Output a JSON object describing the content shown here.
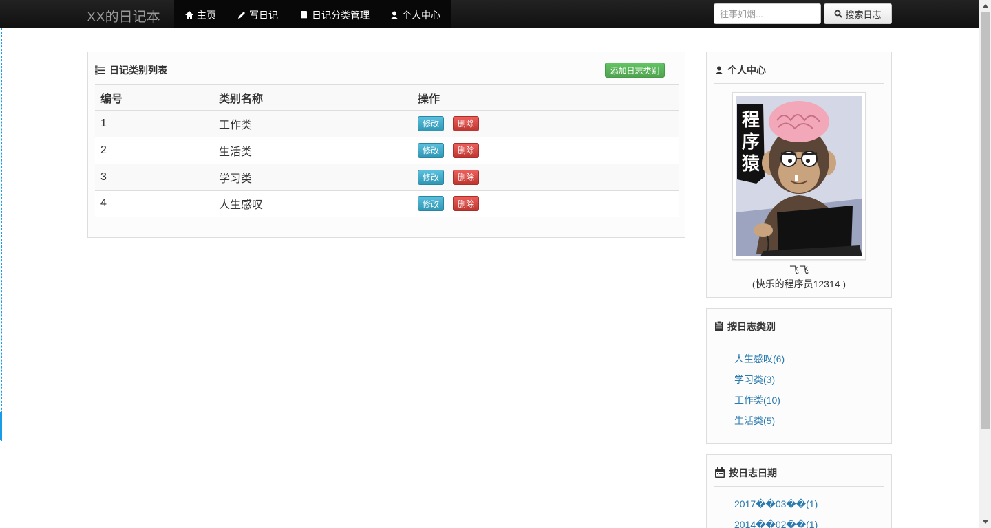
{
  "navbar": {
    "brand": "XX的日记本",
    "items": [
      {
        "label": "主页",
        "icon": "home-icon"
      },
      {
        "label": "写日记",
        "icon": "pencil-icon"
      },
      {
        "label": "日记分类管理",
        "icon": "book-icon"
      },
      {
        "label": "个人中心",
        "icon": "user-icon"
      }
    ],
    "search_placeholder": "往事如烟...",
    "search_button": "搜索日志"
  },
  "main": {
    "title": "日记类别列表",
    "add_button": "添加日志类别",
    "columns": [
      "编号",
      "类别名称",
      "操作"
    ],
    "rows": [
      {
        "id": "1",
        "name": "工作类"
      },
      {
        "id": "2",
        "name": "生活类"
      },
      {
        "id": "3",
        "name": "学习类"
      },
      {
        "id": "4",
        "name": "人生感叹"
      }
    ],
    "edit_label": "修改",
    "delete_label": "删除"
  },
  "sidebar": {
    "profile": {
      "title": "个人中心",
      "avatar_text": "程序猿",
      "name": "飞飞",
      "motto": "(快乐的程序员12314 )"
    },
    "categories": {
      "title": "按日志类别",
      "items": [
        "人生感叹(6)",
        "学习类(3)",
        "工作类(10)",
        "生活类(5)"
      ]
    },
    "dates": {
      "title": "按日志日期",
      "items": [
        "2017��03��(1)",
        "2014��02��(1)"
      ]
    }
  },
  "colors": {
    "navbar": "#111111",
    "link": "#2a7ab0",
    "success": "#51a351",
    "info": "#2f96b4",
    "danger": "#bd362f"
  }
}
